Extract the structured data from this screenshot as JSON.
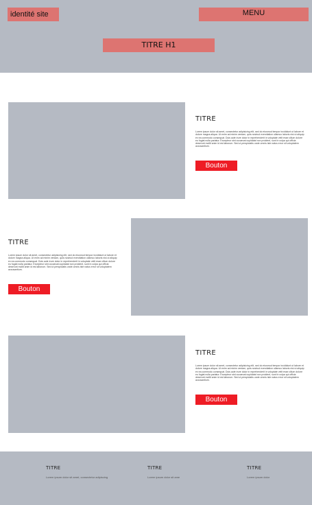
{
  "header": {
    "site_identity": "identité site",
    "menu": "MENU",
    "h1": "TITRE H1"
  },
  "sections": [
    {
      "title": "TITRE",
      "body": "Lorem ipsum dolor sit amet, consectetur adipisicing elit, sed do eiusmod tempor incididunt ut labore et dolore magna aliqua. Ut enim ad minim veniam, quis nostrud exercitation ullamco laboris nisi ut aliquip ex ea commodo consequat. Duis aute irure dolor in reprehenderit in voluptate velit esse cillum dolore eu fugiat nulla pariatur. Excepteur sint occaecat cupidatat non proident, sunt in culpa qui officia deserunt mollit anim id est laborum. Sed ut perspiciatis unde omnis iste natus error sit voluptatem accusantium.",
      "button": "Bouton"
    },
    {
      "title": "TITRE",
      "body": "Lorem ipsum dolor sit amet, consectetur adipisicing elit, sed do eiusmod tempor incididunt ut labore et dolore magna aliqua. Ut enim ad minim veniam, quis nostrud exercitation ullamco laboris nisi ut aliquip ex ea commodo consequat. Duis aute irure dolor in reprehenderit in voluptate velit esse cillum dolore eu fugiat nulla pariatur. Excepteur sint occaecat cupidatat non proident, sunt in culpa qui officia deserunt mollit anim id est laborum. Sed ut perspiciatis unde omnis iste natus error sit voluptatem accusantium.",
      "button": "Bouton"
    },
    {
      "title": "TITRE",
      "body": "Lorem ipsum dolor sit amet, consectetur adipisicing elit, sed do eiusmod tempor incididunt ut labore et dolore magna aliqua. Ut enim ad minim veniam, quis nostrud exercitation ullamco laboris nisi ut aliquip ex ea commodo consequat. Duis aute irure dolor in reprehenderit in voluptate velit esse cillum dolore eu fugiat nulla pariatur. Excepteur sint occaecat cupidatat non proident, sunt in culpa qui officia deserunt mollit anim id est laborum. Sed ut perspiciatis unde omnis iste natus error sit voluptatem accusantium.",
      "button": "Bouton"
    }
  ],
  "footer": {
    "columns": [
      {
        "title": "TITRE",
        "text": "Lorem ipsum dolor sit amet, consectetur adipiscing"
      },
      {
        "title": "TITRE",
        "text": "Lorem ipsum dolor sit ame"
      },
      {
        "title": "TITRE",
        "text": "Lorem ipsum dolor"
      }
    ]
  },
  "colors": {
    "header_bg": "#b5bac3",
    "placeholder_bg": "#dd7471",
    "button_bg": "#ee1c25",
    "image_placeholder": "#b5bac3"
  }
}
